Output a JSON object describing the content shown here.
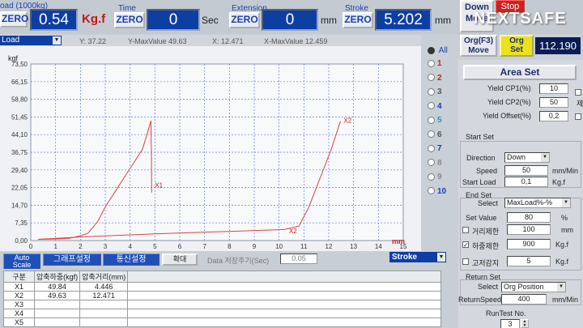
{
  "top": {
    "load_title": "oad (1000kg)",
    "load_zero": "ZERO",
    "load_value": "0.54",
    "load_unit": "Kg.f",
    "time_title": "Time",
    "time_zero": "ZERO",
    "time_value": "0",
    "time_unit": "Sec",
    "ext_title": "Extension",
    "ext_zero": "ZERO",
    "ext_value": "0",
    "ext_unit": "mm",
    "stroke_title": "Stroke",
    "stroke_zero": "ZERO",
    "stroke_value": "5.202",
    "stroke_unit": "mm",
    "down_move": "Down\nMove",
    "stop": "Stop",
    "logo": "NEXTSAFE",
    "org_move": "Org(F3)\nMove",
    "org_set": "Org\nSet",
    "org_value": "112.190"
  },
  "status": {
    "load_select": "Load",
    "y_text": "Y:  37.22",
    "ymax_text": "Y-MaxValue  49.63",
    "x_text": "X:  12.471",
    "xmax_text": "X-MaxValue     12.459"
  },
  "chart_data": {
    "type": "line",
    "ylabel": "kgf",
    "xlabel": "mm",
    "x_ticks": [
      "0",
      "1",
      "2",
      "3",
      "4",
      "5",
      "6",
      "7",
      "8",
      "9",
      "10",
      "11",
      "12",
      "13",
      "14",
      "15"
    ],
    "y_ticks": [
      "0,00",
      "7,35",
      "14,70",
      "22,05",
      "29,40",
      "36,75",
      "44,10",
      "51,45",
      "58,80",
      "66,15",
      "73,50"
    ],
    "xlim": [
      0,
      15
    ],
    "ylim": [
      0,
      73.5
    ],
    "grid": true,
    "series": [
      {
        "name": "X1",
        "color": "#e04040",
        "points": [
          [
            0.3,
            0.5
          ],
          [
            0.8,
            0.6
          ],
          [
            1.5,
            0.8
          ],
          [
            2,
            2
          ],
          [
            2.3,
            3
          ],
          [
            2.7,
            8
          ],
          [
            3,
            14
          ],
          [
            3.5,
            22
          ],
          [
            4,
            30
          ],
          [
            4.5,
            38
          ],
          [
            4.84,
            49.84
          ],
          [
            4.86,
            36
          ],
          [
            4.87,
            20
          ]
        ]
      },
      {
        "name": "X2",
        "color": "#e04040",
        "points": [
          [
            0.3,
            0.5
          ],
          [
            2,
            1.5
          ],
          [
            5,
            2.8
          ],
          [
            8,
            3.8
          ],
          [
            10.2,
            4.6
          ],
          [
            10.8,
            6
          ],
          [
            11.2,
            14
          ],
          [
            11.5,
            22
          ],
          [
            11.8,
            30
          ],
          [
            12.1,
            38
          ],
          [
            12.471,
            49.63
          ]
        ]
      }
    ],
    "annotations": [
      {
        "text": "X1",
        "x": 5.0,
        "y": 22
      },
      {
        "text": "X2",
        "x": 12.6,
        "y": 49
      },
      {
        "text": "X2",
        "x": 10.4,
        "y": 3
      }
    ]
  },
  "channels": {
    "all_label": "All",
    "items": [
      "1",
      "2",
      "3",
      "4",
      "5",
      "6",
      "7",
      "8",
      "9",
      "10"
    ]
  },
  "right": {
    "area_set": "Area Set",
    "yield_cp1_label": "Yield CP1(%)",
    "yield_cp1_value": "10",
    "yield_cp2_label": "Yield CP2(%)",
    "yield_cp2_value": "50",
    "yield_offset_label": "Yield Offset(%)",
    "yield_offset_value": "0,2",
    "edge_label": "제",
    "start_set_title": "Start Set",
    "direction_label": "Direction",
    "direction_value": "Down",
    "speed_label": "Speed",
    "speed_value": "50",
    "speed_unit": "mm/Min",
    "start_load_label": "Start Load",
    "start_load_value": "0,1",
    "start_load_unit": "Kg.f",
    "end_set_title": "End Set",
    "select_label": "Select",
    "select_value": "MaxLoad%-%",
    "set_value_label": "Set Value",
    "set_value": "80",
    "set_value_unit": "%",
    "dist_label": "거리제한",
    "dist_value": "100",
    "dist_unit": "mm",
    "load_limit_label": "하중제한",
    "load_limit_value": "900",
    "load_limit_unit": "Kg.f",
    "fixed_label": "고저감지",
    "fixed_value": "5",
    "fixed_unit": "Kg.f",
    "return_set_title": "Return Set",
    "return_select_label": "Select",
    "return_select_value": "Org Position",
    "return_speed_label": "ReturnSpeed",
    "return_speed_value": "400",
    "return_speed_unit": "mm/Min",
    "run_test_title": "RunTest No.",
    "run_test_value": "3"
  },
  "bottom": {
    "auto_scale": "Auto\nScale",
    "graph_settings": "그래프설정",
    "comm_settings": "통신설정",
    "zoom": "확대",
    "data_period_label": "Data 저장주기(Sec)",
    "data_period_value": "0.05",
    "stroke_select": "Stroke",
    "table_headers": [
      "구분",
      "압축하중(kgf)",
      "압축거리(mm)"
    ],
    "table_rows": [
      [
        "X1",
        "49.84",
        "4.446"
      ],
      [
        "X2",
        "49.63",
        "12.471"
      ],
      [
        "X3",
        "",
        ""
      ],
      [
        "X4",
        "",
        ""
      ],
      [
        "X5",
        "",
        ""
      ]
    ]
  }
}
